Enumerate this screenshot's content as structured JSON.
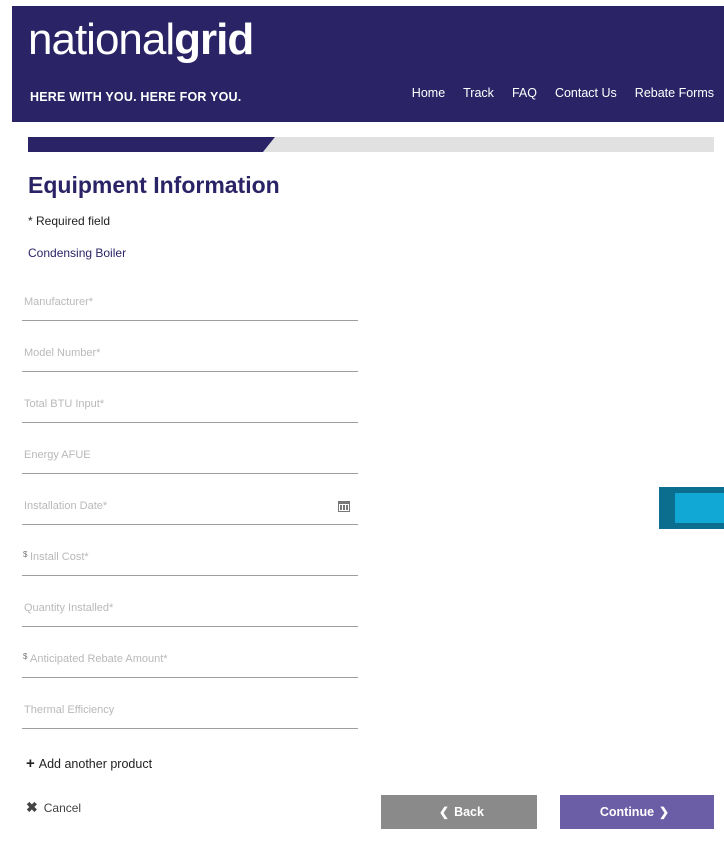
{
  "header": {
    "logo_light": "national",
    "logo_bold": "grid",
    "tagline": "HERE WITH YOU. HERE FOR YOU.",
    "nav": [
      "Home",
      "Track",
      "FAQ",
      "Contact Us",
      "Rebate Forms"
    ],
    "bar_color": "#2a2466"
  },
  "progress": {
    "fraction": 0.36
  },
  "page": {
    "title": "Equipment Information",
    "required_note": "* Required field",
    "product_type": "Condensing Boiler"
  },
  "fields": {
    "manufacturer": "Manufacturer*",
    "model_number": "Model Number*",
    "total_btu_input": "Total BTU Input*",
    "energy_afue": "Energy AFUE",
    "installation_date": "Installation Date*",
    "install_cost": "Install Cost*",
    "install_cost_prefix": "$",
    "quantity_installed": "Quantity Installed*",
    "anticipated_rebate": "Anticipated Rebate Amount*",
    "anticipated_rebate_prefix": "$",
    "thermal_efficiency": "Thermal Efficiency"
  },
  "actions": {
    "add_product": "Add another product",
    "cancel": "Cancel",
    "back": "Back",
    "continue": "Continue"
  },
  "icons": {
    "plus": "plus-icon",
    "cancel": "close-icon",
    "calendar": "calendar-icon",
    "back": "chevron-left-icon",
    "continue": "chevron-right-icon"
  },
  "colors": {
    "accent": "#2a2466",
    "back_button": "#8a8a8a",
    "continue_button": "#6c5ea6",
    "side_tab": "#12a8d6"
  }
}
